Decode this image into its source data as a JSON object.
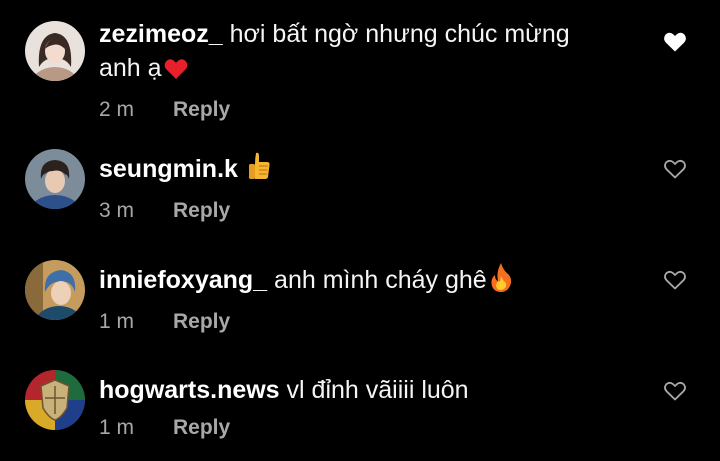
{
  "colors": {
    "background": "#000000",
    "text": "#ffffff",
    "secondary": "#a8a8a8",
    "heart_red": "#e8202c",
    "like_filled": "#ffffff",
    "like_outline": "#a8a8a8"
  },
  "comments": [
    {
      "username": "zezimeoz_",
      "text_line1": "hơi bất ngờ nhưng chúc mừng",
      "text_line2": "anh ạ",
      "emoji": "red-heart-icon",
      "time": "2 m",
      "reply": "Reply",
      "liked": true
    },
    {
      "username": "seungmin.k",
      "text": "",
      "emoji": "thumbs-up-icon",
      "time": "3 m",
      "reply": "Reply",
      "liked": false
    },
    {
      "username": "inniefoxyang_",
      "text": "anh mình cháy ghê",
      "emoji": "fire-icon",
      "time": "1 m",
      "reply": "Reply",
      "liked": false
    },
    {
      "username": "hogwarts.news",
      "text": "vl đỉnh vãiiii luôn",
      "time": "1 m",
      "reply": "Reply",
      "liked": false
    }
  ]
}
